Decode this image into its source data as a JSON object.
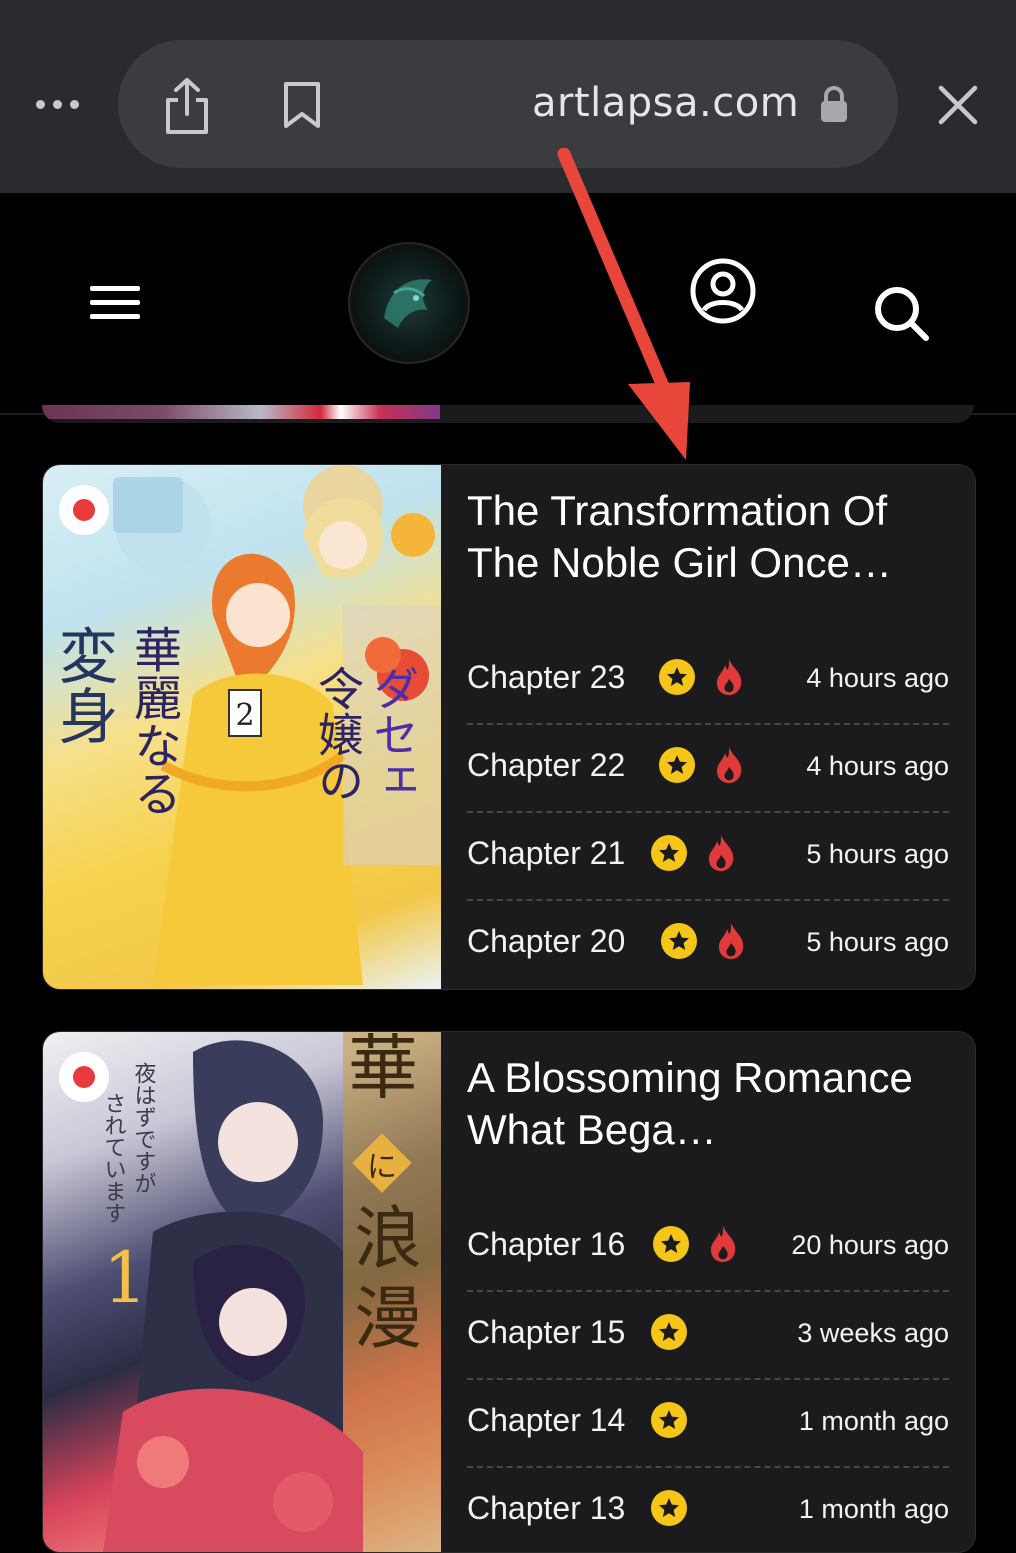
{
  "browser": {
    "url": "artlapsa.com",
    "icons": [
      "more-icon",
      "share-icon",
      "bookmark-icon",
      "lock-icon",
      "close-icon"
    ]
  },
  "header": {
    "icons": [
      "menu-icon",
      "logo",
      "account-icon",
      "search-icon"
    ]
  },
  "colors": {
    "star": "#f5c518",
    "fire": "#e03a3a",
    "card_bg": "#1b1b1d",
    "arrow": "#e8463a"
  },
  "manga": [
    {
      "title": "The Transformation Of The Noble Girl Once…",
      "cover_text": "ダセェと言われた令嬢の華麗なる変身",
      "chapters": [
        {
          "label": "Chapter 23",
          "time": "4 hours ago",
          "star": true,
          "hot": true
        },
        {
          "label": "Chapter 22",
          "time": "4 hours ago",
          "star": true,
          "hot": true
        },
        {
          "label": "Chapter 21",
          "time": "5 hours ago",
          "star": true,
          "hot": true
        },
        {
          "label": "Chapter 20",
          "time": "5 hours ago",
          "star": true,
          "hot": true
        }
      ]
    },
    {
      "title": "A Blossoming Romance What Bega…",
      "cover_text": "華に浪漫",
      "chapters": [
        {
          "label": "Chapter 16",
          "time": "20 hours ago",
          "star": true,
          "hot": true
        },
        {
          "label": "Chapter 15",
          "time": "3 weeks ago",
          "star": true,
          "hot": false
        },
        {
          "label": "Chapter 14",
          "time": "1 month ago",
          "star": true,
          "hot": false
        },
        {
          "label": "Chapter 13",
          "time": "1 month ago",
          "star": true,
          "hot": false
        }
      ]
    }
  ]
}
